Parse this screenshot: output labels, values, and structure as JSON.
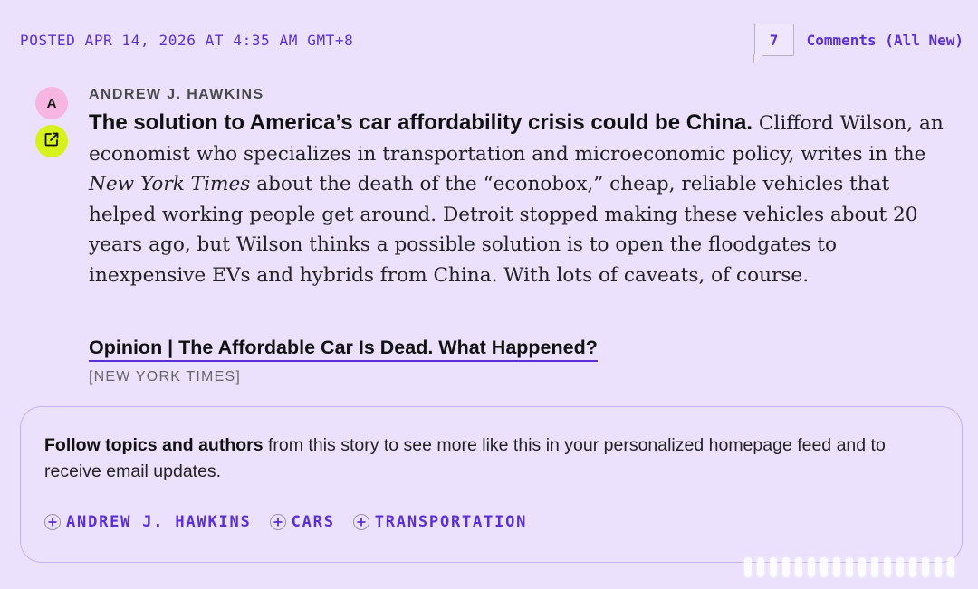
{
  "header": {
    "posted": "POSTED APR 14, 2026 AT 4:35 AM GMT+8",
    "comment_count": "7",
    "comments_link": "Comments (All New)"
  },
  "author": {
    "initial": "A",
    "name": "ANDREW J. HAWKINS"
  },
  "post": {
    "headline": "The solution to America’s car affordability crisis could be China.",
    "body_before": " Clifford Wilson, an economist who specializes in transportation and microeconomic policy, writes in the ",
    "publication": "New York Times",
    "body_after": " about the death of the “econobox,” cheap, reliable vehicles that helped working people get around. Detroit stopped making these vehicles about 20 years ago, but Wilson thinks a possible solution is to open the floodgates to inexpensive EVs and hybrids from China. With lots of caveats, of course.",
    "link_title": "Opinion | The Affordable Car Is Dead. What Happened?",
    "link_source": "[NEW YORK TIMES]"
  },
  "follow": {
    "bold": "Follow topics and authors",
    "text": " from this story to see more like this in your personalized homepage feed and to receive email updates.",
    "topics": [
      "ANDREW J. HAWKINS",
      "CARS",
      "TRANSPORTATION"
    ]
  },
  "icons": {
    "share": "external-link-icon",
    "plus": "plus-circle-icon"
  },
  "colors": {
    "background": "#ebe1fc",
    "accent": "#5a2fd6",
    "avatar": "#f7b6e2",
    "share_button": "#d6f21a"
  }
}
